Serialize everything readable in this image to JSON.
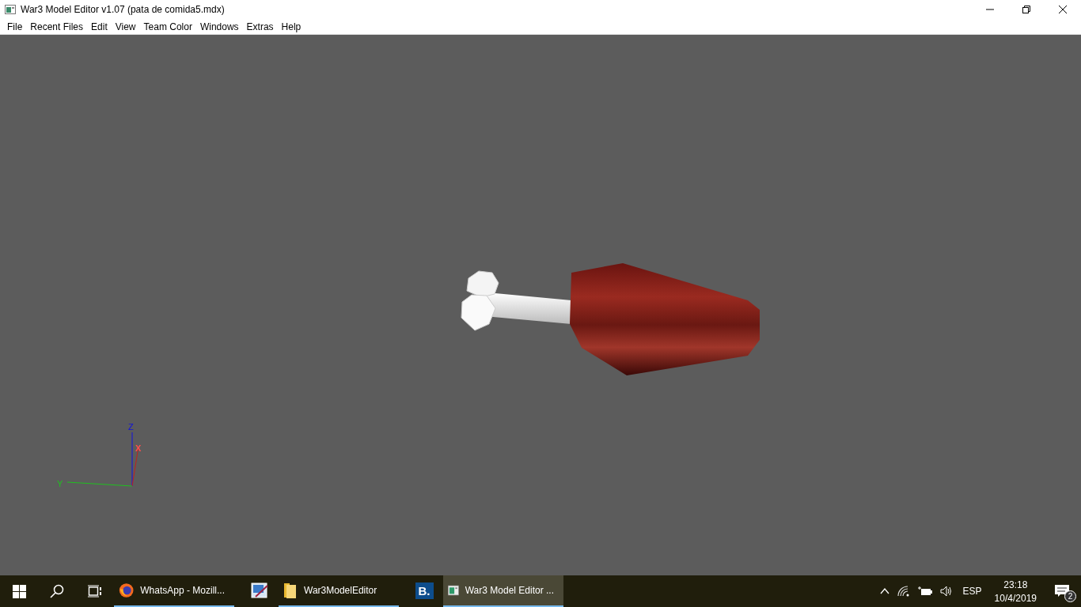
{
  "window": {
    "title": "War3 Model Editor v1.07 (pata de comida5.mdx)"
  },
  "menu": [
    "File",
    "Recent Files",
    "Edit",
    "View",
    "Team Color",
    "Windows",
    "Extras",
    "Help"
  ],
  "viewport": {
    "axes": {
      "z": "Z",
      "x": "X",
      "y": "Y"
    }
  },
  "taskbar": {
    "items": [
      {
        "kind": "firefox",
        "label": "WhatsApp - Mozill...",
        "running": true,
        "selected": false
      },
      {
        "kind": "paint",
        "running": false,
        "selected": false
      },
      {
        "kind": "folder",
        "label": "War3ModelEditor",
        "running": true,
        "selected": false
      },
      {
        "kind": "letter",
        "glyph": "B.",
        "running": false,
        "selected": false
      },
      {
        "kind": "war3",
        "label": "War3 Model Editor ...",
        "running": true,
        "selected": true
      }
    ],
    "language": "ESP",
    "time": "23:18",
    "date": "10/4/2019",
    "notifications": "2"
  }
}
